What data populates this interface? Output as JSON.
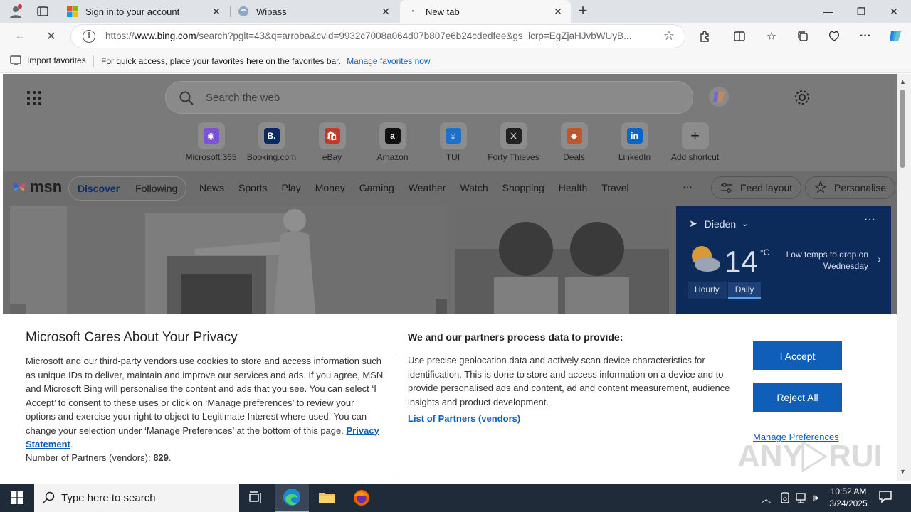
{
  "browser": {
    "tabs": [
      {
        "title": "Sign in to your account",
        "icon": "microsoft-icon"
      },
      {
        "title": "Wipass",
        "icon": "wipass-icon"
      },
      {
        "title": "New tab",
        "icon": "loading-icon"
      }
    ],
    "url": {
      "prefix": "https://",
      "domain": "www.bing.com",
      "rest": "/search?pglt=43&q=arroba&cvid=9932c7008a064d07b807e6b24cdedfee&gs_lcrp=EgZjaHJvbWUyB..."
    },
    "favorites_bar": {
      "import_label": "Import favorites",
      "hint": "For quick access, place your favorites here on the favorites bar.",
      "manage_link": "Manage favorites now"
    }
  },
  "ntp": {
    "search_placeholder": "Search the web",
    "shortcuts": [
      {
        "label": "Microsoft 365",
        "icon": "m365-icon",
        "color": "#7b52d9",
        "glyph": "◉"
      },
      {
        "label": "Booking.com",
        "icon": "booking-icon",
        "color": "#0b2a63",
        "glyph": "B."
      },
      {
        "label": "eBay",
        "icon": "ebay-icon",
        "color": "#c0392b",
        "glyph": "🛍"
      },
      {
        "label": "Amazon",
        "icon": "amazon-icon",
        "color": "#111111",
        "glyph": "a"
      },
      {
        "label": "TUI",
        "icon": "tui-icon",
        "color": "#1b70c9",
        "glyph": "☺"
      },
      {
        "label": "Forty Thieves",
        "icon": "forty-thieves-icon",
        "color": "#222222",
        "glyph": "⚔"
      },
      {
        "label": "Deals",
        "icon": "deals-icon",
        "color": "#c0562b",
        "glyph": "◆"
      },
      {
        "label": "LinkedIn",
        "icon": "linkedin-icon",
        "color": "#0a66c2",
        "glyph": "in"
      },
      {
        "label": "Add shortcut",
        "icon": "plus-icon",
        "color": "#555555",
        "glyph": "+"
      }
    ],
    "msn": {
      "logo": "msn",
      "discover": "Discover",
      "following": "Following",
      "nav": [
        "News",
        "Sports",
        "Play",
        "Money",
        "Gaming",
        "Weather",
        "Watch",
        "Shopping",
        "Health",
        "Travel"
      ],
      "more": "···",
      "feed_layout": "Feed layout",
      "personalise": "Personalise"
    },
    "weather": {
      "location": "Dieden",
      "temp": "14",
      "unit": "°C",
      "note": "Low temps to drop on Wednesday",
      "tabs": [
        "Hourly",
        "Daily"
      ]
    }
  },
  "consent": {
    "title": "Microsoft Cares About Your Privacy",
    "body": "Microsoft and our third-party vendors use cookies to store and access information such as unique IDs to deliver, maintain and improve our services and ads. If you agree, MSN and Microsoft Bing will personalise the content and ads that you see. You can select ‘I Accept’ to consent to these uses or click on ‘Manage preferences’ to review your options and exercise your right to object to Legitimate Interest where used.  You can change your selection under ‘Manage Preferences’ at the bottom of this page.",
    "privacy_link": "Privacy Statement",
    "partners_label": "Number of Partners (vendors):",
    "partners_count": "829",
    "right_title": "We and our partners process data to provide:",
    "right_body": "Use precise geolocation data and actively scan device characteristics for identification. This is done to store and access information on a device and to provide personalised ads and content, ad and content measurement, audience insights and product development.",
    "list_partners": "List of Partners (vendors)",
    "accept": "I Accept",
    "reject": "Reject All",
    "manage": "Manage Preferences",
    "accent": "#0f5fb8"
  },
  "taskbar": {
    "search_placeholder": "Type here to search",
    "time": "10:52 AM",
    "date": "3/24/2025"
  }
}
